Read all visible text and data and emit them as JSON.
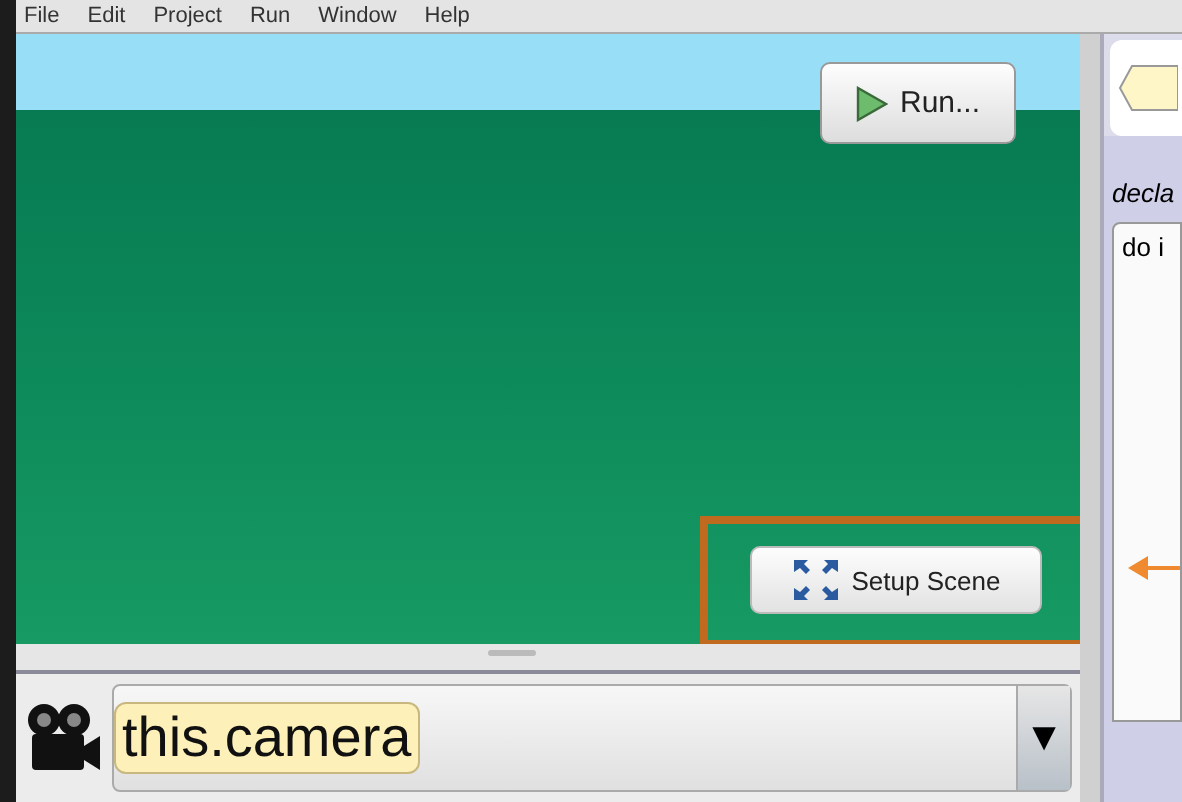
{
  "menu": [
    {
      "label": "File"
    },
    {
      "label": "Edit"
    },
    {
      "label": "Project"
    },
    {
      "label": "Run"
    },
    {
      "label": "Window"
    },
    {
      "label": "Help"
    }
  ],
  "scene": {
    "run_button": "Run...",
    "setup_button": "Setup Scene",
    "highlighted": true
  },
  "camera_bar": {
    "selection": "this.camera",
    "dropdown": "▼"
  },
  "code_panel": {
    "header": "decla",
    "block": "do i"
  }
}
